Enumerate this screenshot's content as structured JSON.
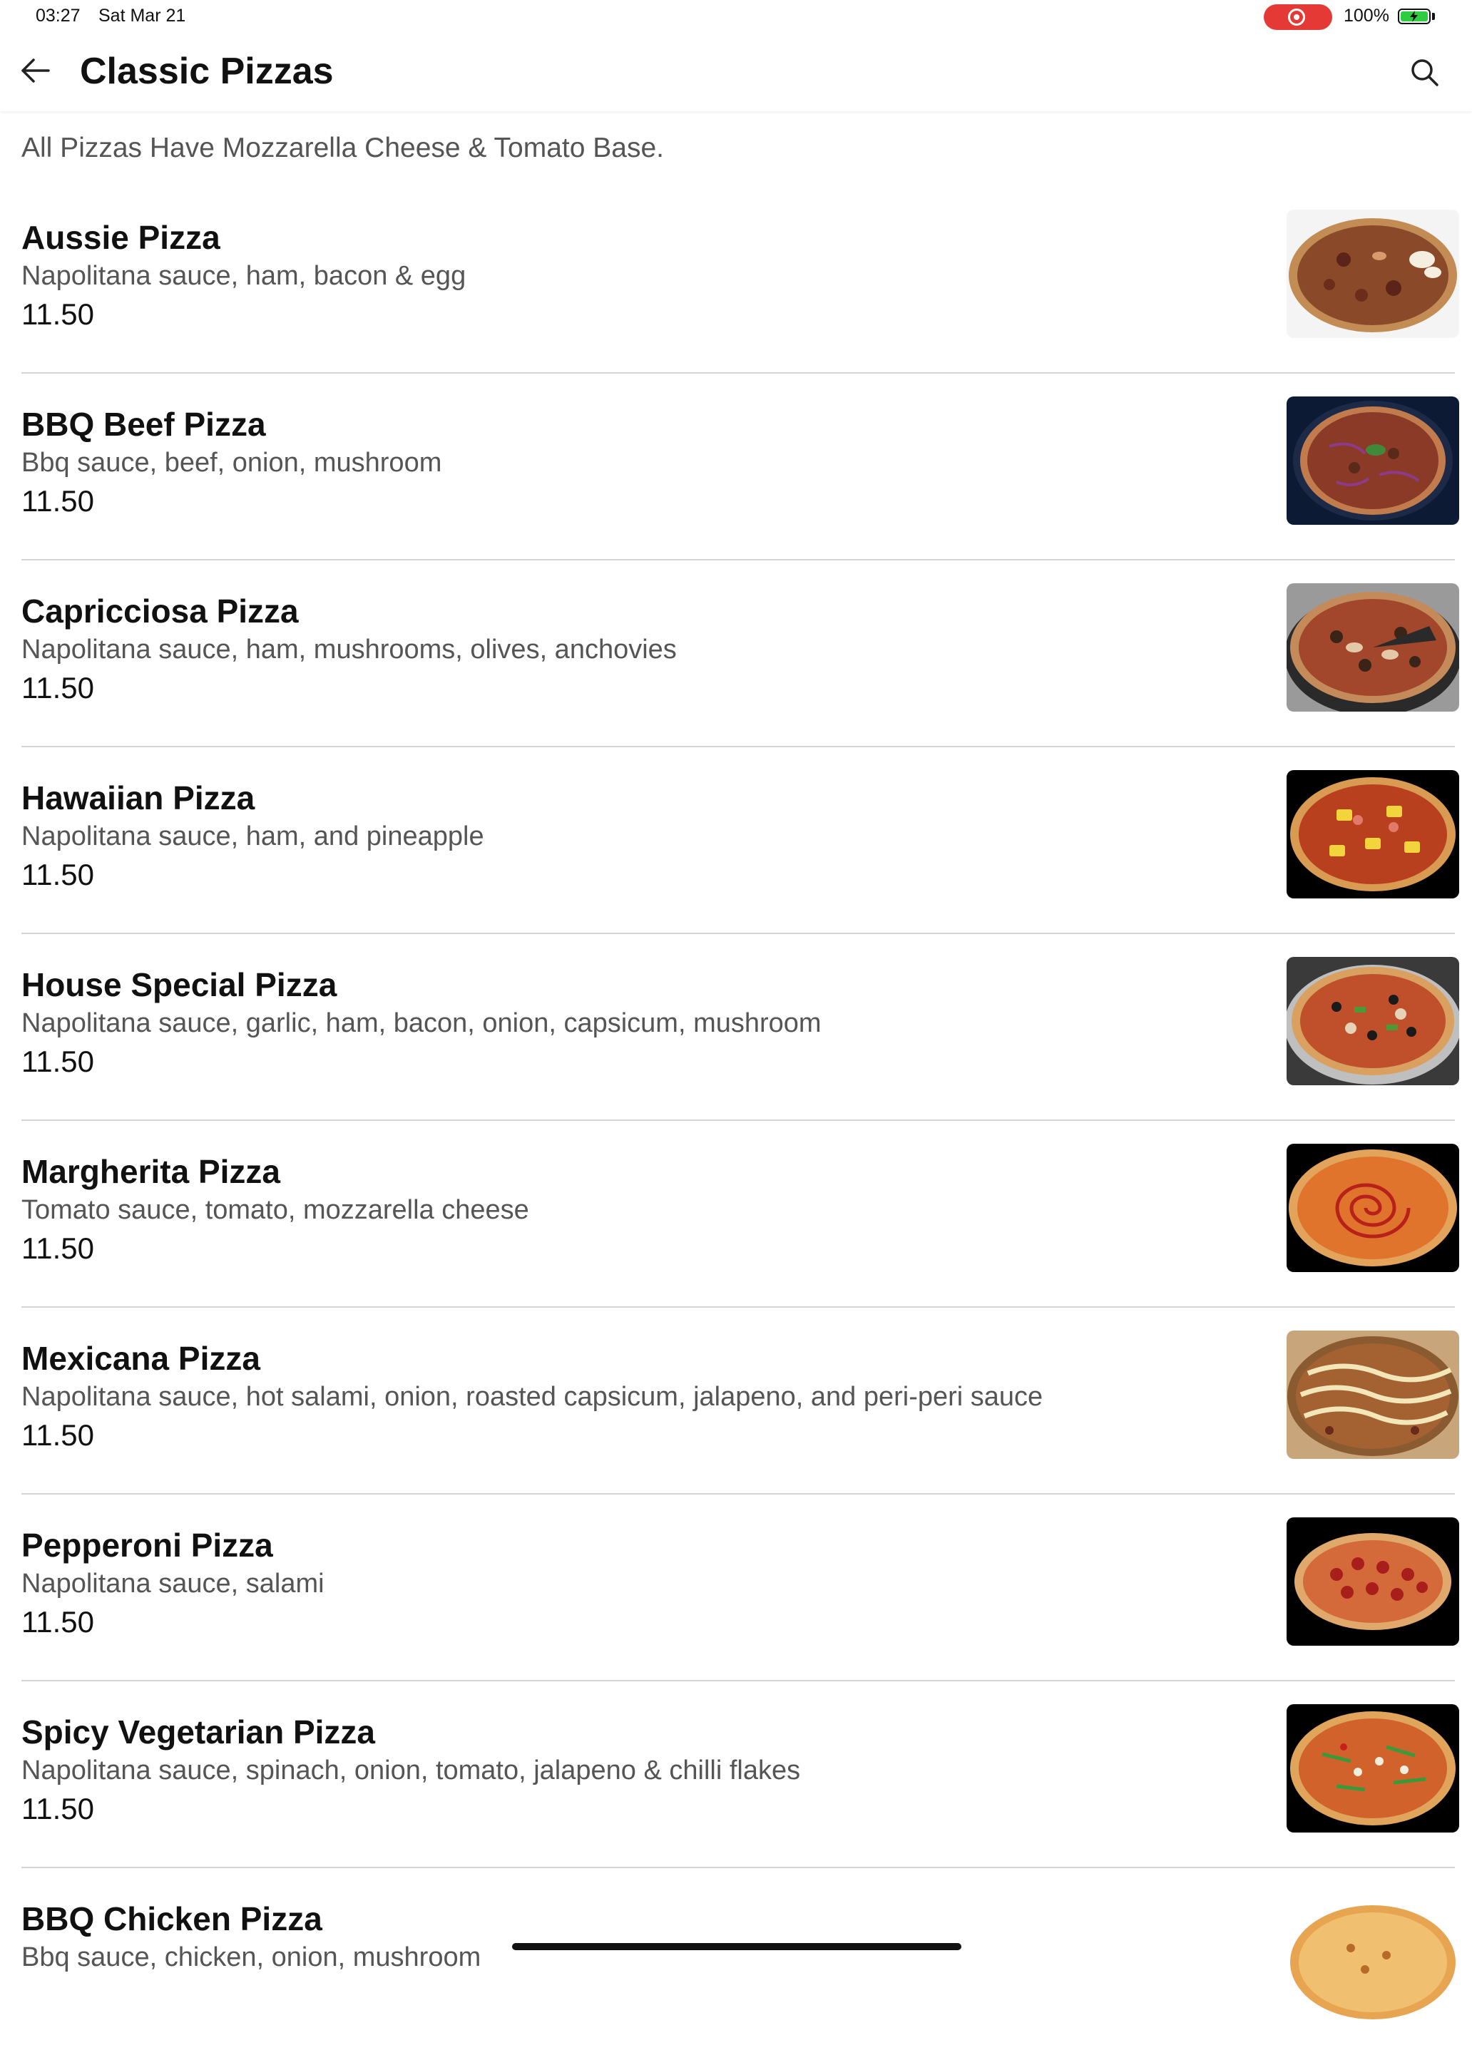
{
  "status_bar": {
    "time": "03:27",
    "date": "Sat Mar 21",
    "battery_percent": "100%",
    "recording_color": "#e53935",
    "battery_color": "#2ecc40"
  },
  "header": {
    "title": "Classic Pizzas",
    "back_icon": "arrow-left-icon",
    "search_icon": "search-icon"
  },
  "subtitle": "All Pizzas Have Mozzarella Cheese & Tomato Base.",
  "items": [
    {
      "name": "Aussie Pizza",
      "description": "Napolitana sauce, ham, bacon & egg",
      "price": "11.50",
      "image_bg": "#f4f4f4"
    },
    {
      "name": "BBQ Beef Pizza",
      "description": "Bbq sauce, beef, onion, mushroom",
      "price": "11.50",
      "image_bg": "#0d1a33"
    },
    {
      "name": "Capricciosa Pizza",
      "description": "Napolitana sauce, ham, mushrooms, olives, anchovies",
      "price": "11.50",
      "image_bg": "#9a9a9a"
    },
    {
      "name": "Hawaiian Pizza",
      "description": "Napolitana sauce, ham, and pineapple",
      "price": "11.50",
      "image_bg": "#000000"
    },
    {
      "name": "House Special Pizza",
      "description": "Napolitana sauce, garlic, ham, bacon, onion, capsicum, mushroom",
      "price": "11.50",
      "image_bg": "#3a3a3a"
    },
    {
      "name": "Margherita Pizza",
      "description": "Tomato sauce, tomato, mozzarella cheese",
      "price": "11.50",
      "image_bg": "#000000"
    },
    {
      "name": "Mexicana Pizza",
      "description": "Napolitana sauce, hot salami, onion, roasted capsicum, jalapeno, and peri-peri sauce",
      "price": "11.50",
      "image_bg": "#c8a57a"
    },
    {
      "name": "Pepperoni Pizza",
      "description": "Napolitana sauce, salami",
      "price": "11.50",
      "image_bg": "#000000"
    },
    {
      "name": "Spicy Vegetarian Pizza",
      "description": "Napolitana sauce, spinach, onion, tomato, jalapeno & chilli flakes",
      "price": "11.50",
      "image_bg": "#000000"
    },
    {
      "name": "BBQ Chicken Pizza",
      "description": "Bbq sauce, chicken, onion, mushroom",
      "price": "",
      "image_bg": "#ffffff"
    }
  ]
}
